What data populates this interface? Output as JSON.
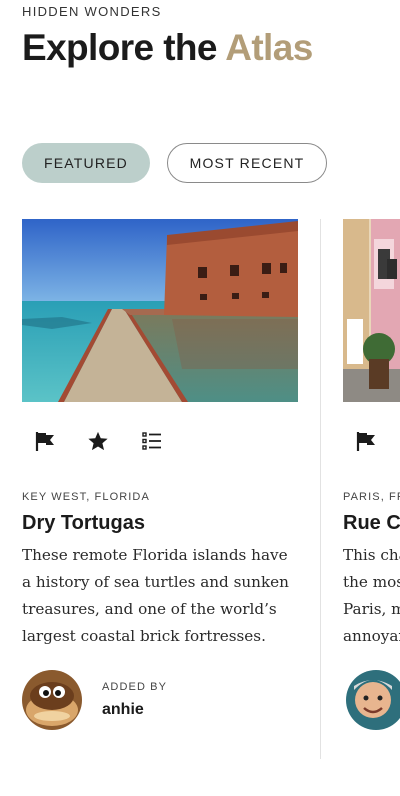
{
  "header": {
    "eyebrow": "HIDDEN WONDERS",
    "title_main": "Explore the ",
    "title_accent": "Atlas",
    "accent_color": "#b29d78"
  },
  "tabs": [
    {
      "label": "FEATURED",
      "active": true,
      "color": "#bccfcb"
    },
    {
      "label": "MOST RECENT",
      "active": false
    }
  ],
  "cards": [
    {
      "location": "KEY WEST, FLORIDA",
      "title": "Dry Tortugas",
      "description": "These remote Florida islands have a history of sea turtles and sunken treasures, and one of the world’s largest coastal brick fortresses.",
      "added_by_label": "ADDED BY",
      "user": "anhie",
      "actions": [
        "flag-icon",
        "star-icon",
        "list-icon"
      ]
    },
    {
      "location": "PARIS, FRA",
      "title": "Rue C",
      "description_lines": [
        "This cha",
        "the mos",
        "Paris, m",
        "annoyar"
      ],
      "actions": [
        "flag-icon"
      ]
    }
  ]
}
